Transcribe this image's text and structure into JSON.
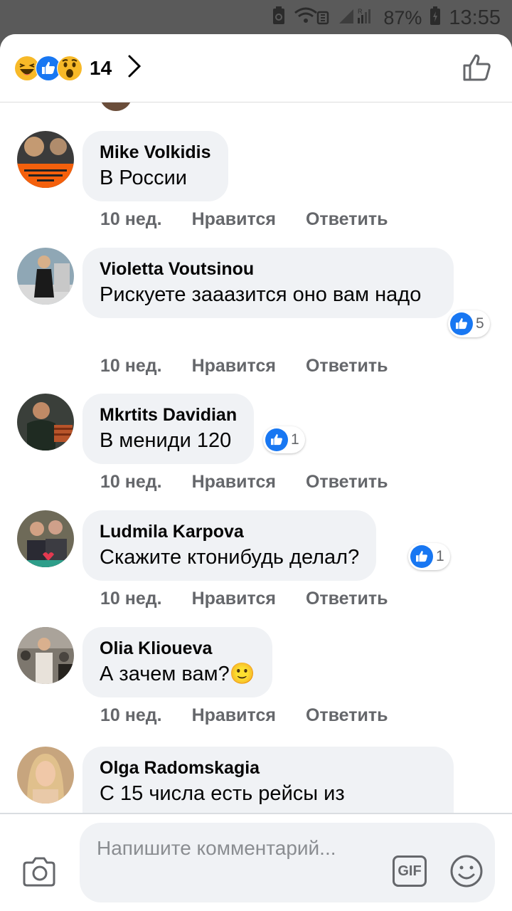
{
  "status_bar": {
    "battery": "87%",
    "time": "13:55"
  },
  "header": {
    "reaction_icons": [
      "haha-reaction-icon",
      "like-reaction-icon",
      "wow-reaction-icon"
    ],
    "reaction_count": "14"
  },
  "comments": [
    {
      "author": "Mike Volkidis",
      "text": "В России",
      "time": "10 нед.",
      "like": "Нравится",
      "reply": "Ответить"
    },
    {
      "author": "Violetta Voutsinou",
      "text": "Рискуете  зааазится  оно вам надо",
      "time": "10 нед.",
      "like": "Нравится",
      "reply": "Ответить",
      "likes": "5"
    },
    {
      "author": "Mkrtits Davidian",
      "text": "В мениди 120",
      "time": "10 нед.",
      "like": "Нравится",
      "reply": "Ответить",
      "likes": "1"
    },
    {
      "author": "Ludmila Karpova",
      "text": "Скажите ктонибудь делал?",
      "time": "10 нед.",
      "like": "Нравится",
      "reply": "Ответить",
      "likes": "1"
    },
    {
      "author": "Olia Klioueva",
      "text": "А зачем вам?",
      "emoji": "🙂",
      "time": "10 нед.",
      "like": "Нравится",
      "reply": "Ответить"
    },
    {
      "author": "Olga Radomskagia",
      "text": "С 15 числа есть рейсы из"
    }
  ],
  "composer": {
    "placeholder": "Напишите комментарий...",
    "gif_label": "GIF"
  },
  "colors": {
    "like_blue": "#1877f2",
    "bubble_bg": "#f0f2f5",
    "meta_gray": "#65676b"
  }
}
